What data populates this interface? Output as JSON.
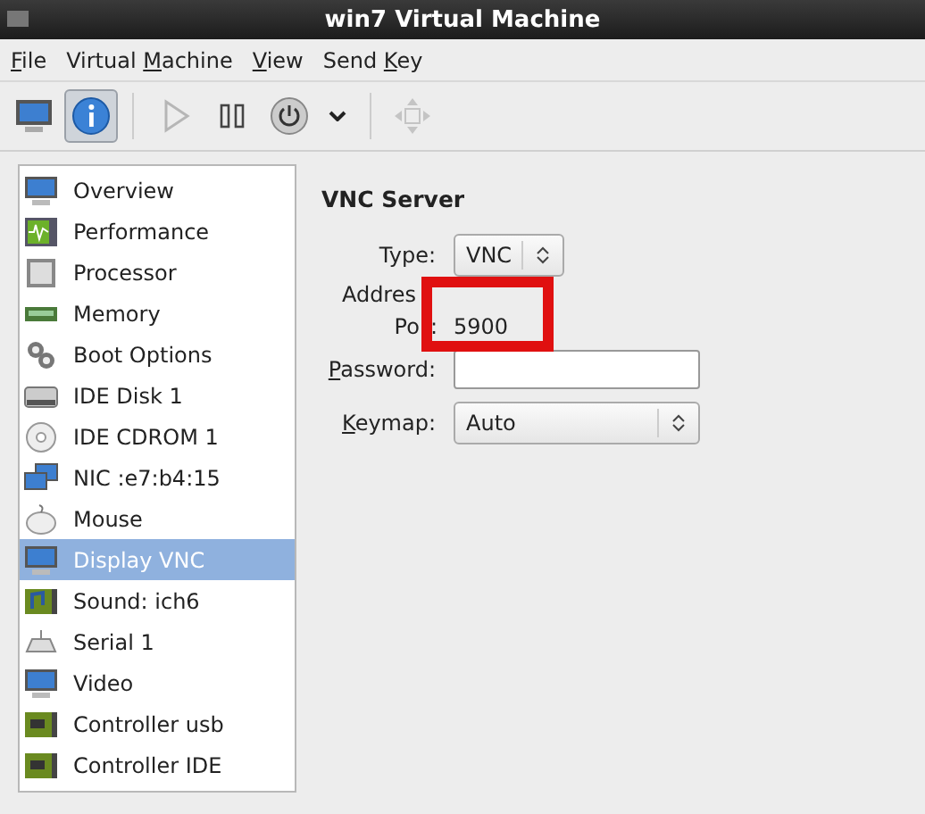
{
  "window": {
    "title": "win7 Virtual Machine"
  },
  "menu": [
    {
      "parts": [
        {
          "text": "F",
          "underline": true
        },
        {
          "text": "ile",
          "underline": false
        }
      ]
    },
    {
      "parts": [
        {
          "text": "Virtual ",
          "underline": false
        },
        {
          "text": "M",
          "underline": true
        },
        {
          "text": "achine",
          "underline": false
        }
      ]
    },
    {
      "parts": [
        {
          "text": "V",
          "underline": true
        },
        {
          "text": "iew",
          "underline": false
        }
      ]
    },
    {
      "parts": [
        {
          "text": "Send ",
          "underline": false
        },
        {
          "text": "K",
          "underline": true
        },
        {
          "text": "ey",
          "underline": false
        }
      ]
    }
  ],
  "toolbar": [
    {
      "kind": "console",
      "selected": false,
      "disabled": false
    },
    {
      "kind": "details",
      "selected": true,
      "disabled": false
    },
    {
      "kind": "separator"
    },
    {
      "kind": "run",
      "selected": false,
      "disabled": true
    },
    {
      "kind": "pause",
      "selected": false,
      "disabled": false
    },
    {
      "kind": "shutdown",
      "selected": false,
      "disabled": false
    },
    {
      "kind": "dropdown",
      "selected": false,
      "disabled": false
    },
    {
      "kind": "separator"
    },
    {
      "kind": "fullscreen",
      "selected": false,
      "disabled": true
    }
  ],
  "sidebar": {
    "items": [
      {
        "label": "Overview",
        "kind": "monitor",
        "selected": false
      },
      {
        "label": "Performance",
        "kind": "graph",
        "selected": false
      },
      {
        "label": "Processor",
        "kind": "chip",
        "selected": false
      },
      {
        "label": "Memory",
        "kind": "ram",
        "selected": false
      },
      {
        "label": "Boot Options",
        "kind": "gears",
        "selected": false
      },
      {
        "label": "IDE Disk 1",
        "kind": "disk",
        "selected": false
      },
      {
        "label": "IDE CDROM 1",
        "kind": "cdrom",
        "selected": false
      },
      {
        "label": "NIC :e7:b4:15",
        "kind": "network",
        "selected": false
      },
      {
        "label": "Mouse",
        "kind": "mouse",
        "selected": false
      },
      {
        "label": "Display VNC",
        "kind": "monitor",
        "selected": true
      },
      {
        "label": "Sound: ich6",
        "kind": "sound",
        "selected": false
      },
      {
        "label": "Serial 1",
        "kind": "serial",
        "selected": false
      },
      {
        "label": "Video",
        "kind": "monitor",
        "selected": false
      },
      {
        "label": "Controller usb",
        "kind": "card",
        "selected": false
      },
      {
        "label": "Controller IDE",
        "kind": "card",
        "selected": false
      }
    ]
  },
  "vnc": {
    "heading": "VNC Server",
    "type": {
      "label": "Type:",
      "value": "VNC"
    },
    "address": {
      "label": "Addres"
    },
    "port": {
      "label": "Po",
      "colon": ":",
      "value": "5900"
    },
    "password": {
      "parts": [
        {
          "text": "P",
          "underline": true
        },
        {
          "text": "assword:",
          "underline": false
        }
      ]
    },
    "keymap": {
      "parts": [
        {
          "text": "K",
          "underline": true
        },
        {
          "text": "eymap:",
          "underline": false
        }
      ],
      "value": "Auto"
    },
    "highlight": {
      "color": "#e01010"
    }
  }
}
